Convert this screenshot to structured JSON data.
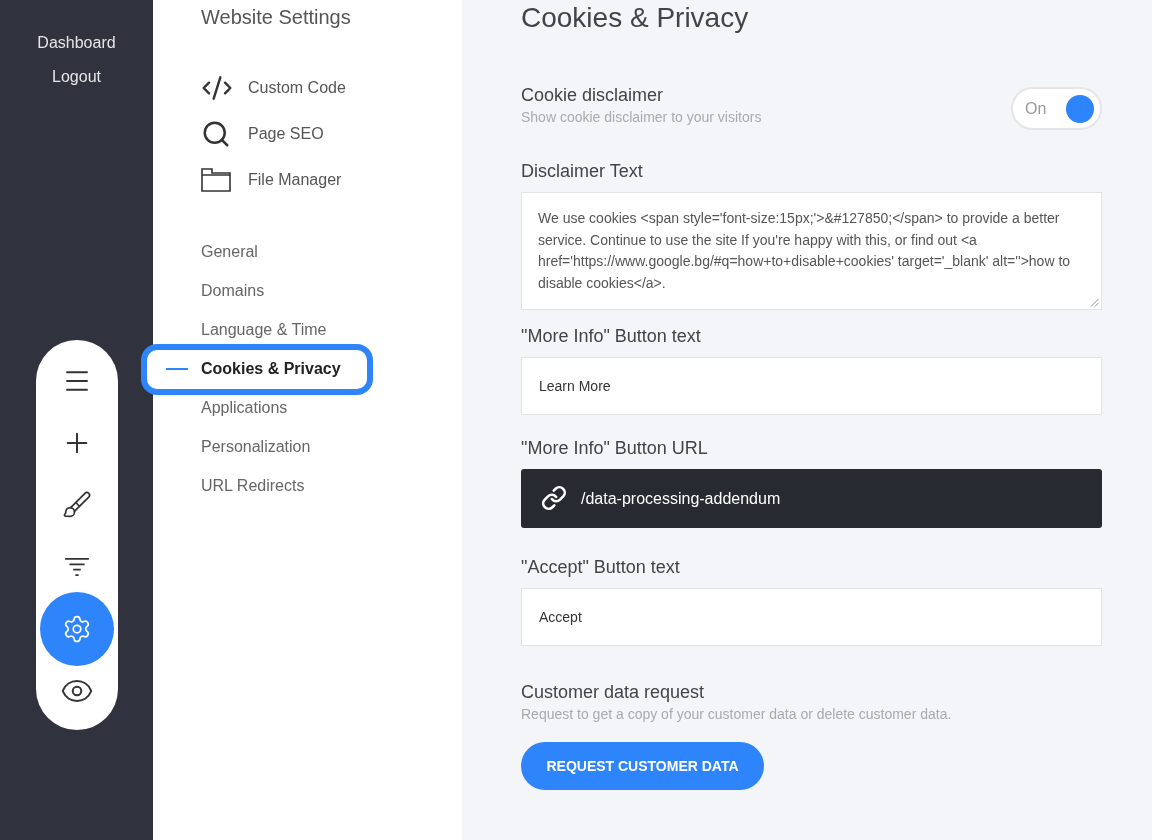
{
  "sidebar": {
    "links": [
      "Dashboard",
      "Logout"
    ],
    "tools": [
      {
        "kind": "menu",
        "selected": false
      },
      {
        "kind": "plus",
        "selected": false
      },
      {
        "kind": "brush",
        "selected": false
      },
      {
        "kind": "filter",
        "selected": false
      },
      {
        "kind": "settings",
        "selected": true
      },
      {
        "kind": "eye",
        "selected": false
      }
    ]
  },
  "settings_menu": {
    "title": "Website Settings",
    "tools": [
      {
        "kind": "code",
        "label": "Custom Code"
      },
      {
        "kind": "search",
        "label": "Page SEO"
      },
      {
        "kind": "folder",
        "label": "File Manager"
      }
    ],
    "items": [
      {
        "label": "General",
        "selected": false
      },
      {
        "label": "Domains",
        "selected": false
      },
      {
        "label": "Language & Time",
        "selected": false
      },
      {
        "label": "Cookies & Privacy",
        "selected": true
      },
      {
        "label": "Applications",
        "selected": false
      },
      {
        "label": "Personalization",
        "selected": false
      },
      {
        "label": "URL Redirects",
        "selected": false
      }
    ]
  },
  "content": {
    "title": "Cookies & Privacy",
    "cookie_disclaimer": {
      "label": "Cookie disclaimer",
      "description": "Show cookie disclaimer to your visitors",
      "toggle": {
        "label": "On",
        "on": true
      }
    },
    "fields": [
      {
        "kind": "textarea",
        "label": "Disclaimer Text",
        "value": "We use cookies <span style='font-size:15px;'>&#127850;</span> to provide a better service. Continue to use the site If you're happy with this, or find out <a href='https://www.google.bg/#q=how+to+disable+cookies' target='_blank' alt=''>how to disable cookies</a>."
      },
      {
        "kind": "text",
        "label": "\"More Info\" Button text",
        "value": "Learn More"
      },
      {
        "kind": "link",
        "label": "\"More Info\" Button URL",
        "value": "/data-processing-addendum"
      },
      {
        "kind": "text",
        "label": "\"Accept\" Button text",
        "value": "Accept"
      }
    ],
    "customer_data": {
      "label": "Customer data request",
      "description": "Request to get a copy of your customer data or delete customer data.",
      "button": "REQUEST CUSTOMER DATA"
    }
  }
}
